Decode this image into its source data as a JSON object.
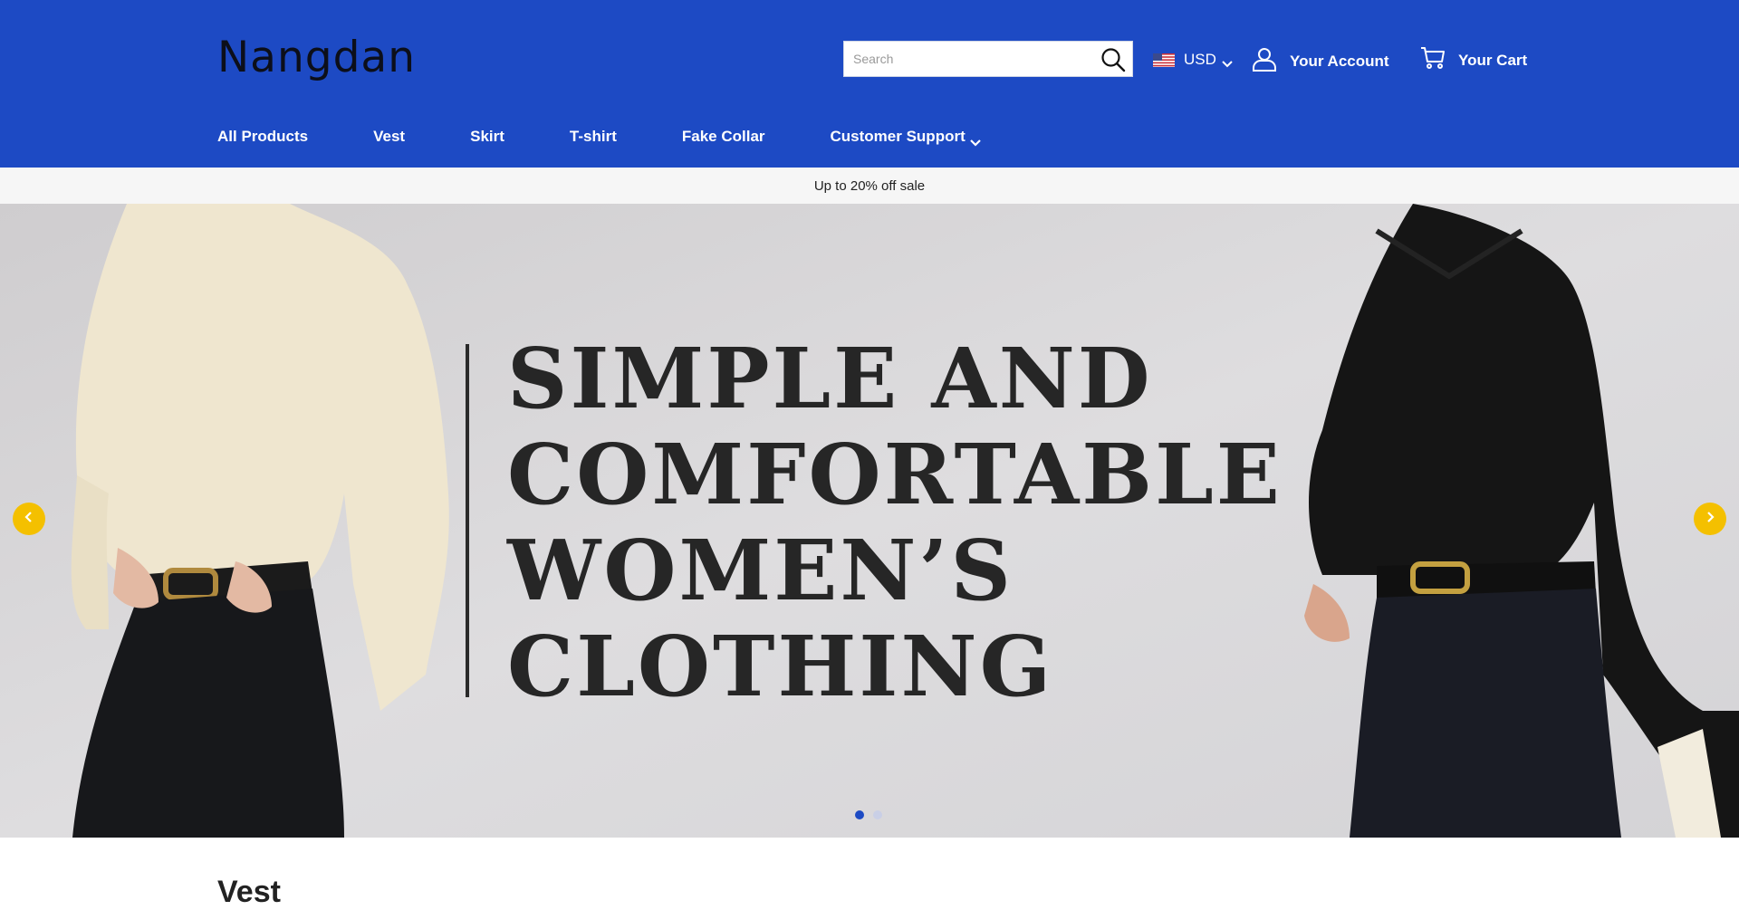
{
  "brand": {
    "logo_text": "Nangdan"
  },
  "colors": {
    "header_bg": "#1d4ac4",
    "promo_bg": "#f6f6f6",
    "arrow_bg": "#f4c000",
    "dot_active": "#1d4ac4"
  },
  "search": {
    "placeholder": "Search",
    "value": "",
    "icon": "search-icon"
  },
  "currency": {
    "code": "USD",
    "icon": "us-flag-icon"
  },
  "account": {
    "label": "Your Account",
    "icon": "user-icon"
  },
  "cart": {
    "label": "Your Cart",
    "icon": "cart-icon"
  },
  "nav": {
    "items": [
      {
        "label": "All Products"
      },
      {
        "label": "Vest"
      },
      {
        "label": "Skirt"
      },
      {
        "label": "T-shirt"
      },
      {
        "label": "Fake Collar"
      },
      {
        "label": "Customer Support",
        "icon": "chevron-down-icon"
      }
    ]
  },
  "promo": {
    "text": "Up to 20% off sale"
  },
  "hero": {
    "headline_lines": [
      "SIMPLE AND",
      "COMFORTABLE",
      "WOMEN’S",
      "CLOTHING"
    ],
    "slides_count": 2,
    "active_slide": 1,
    "prev_icon": "chevron-left-icon",
    "next_icon": "chevron-right-icon"
  },
  "section": {
    "title": "Vest"
  }
}
